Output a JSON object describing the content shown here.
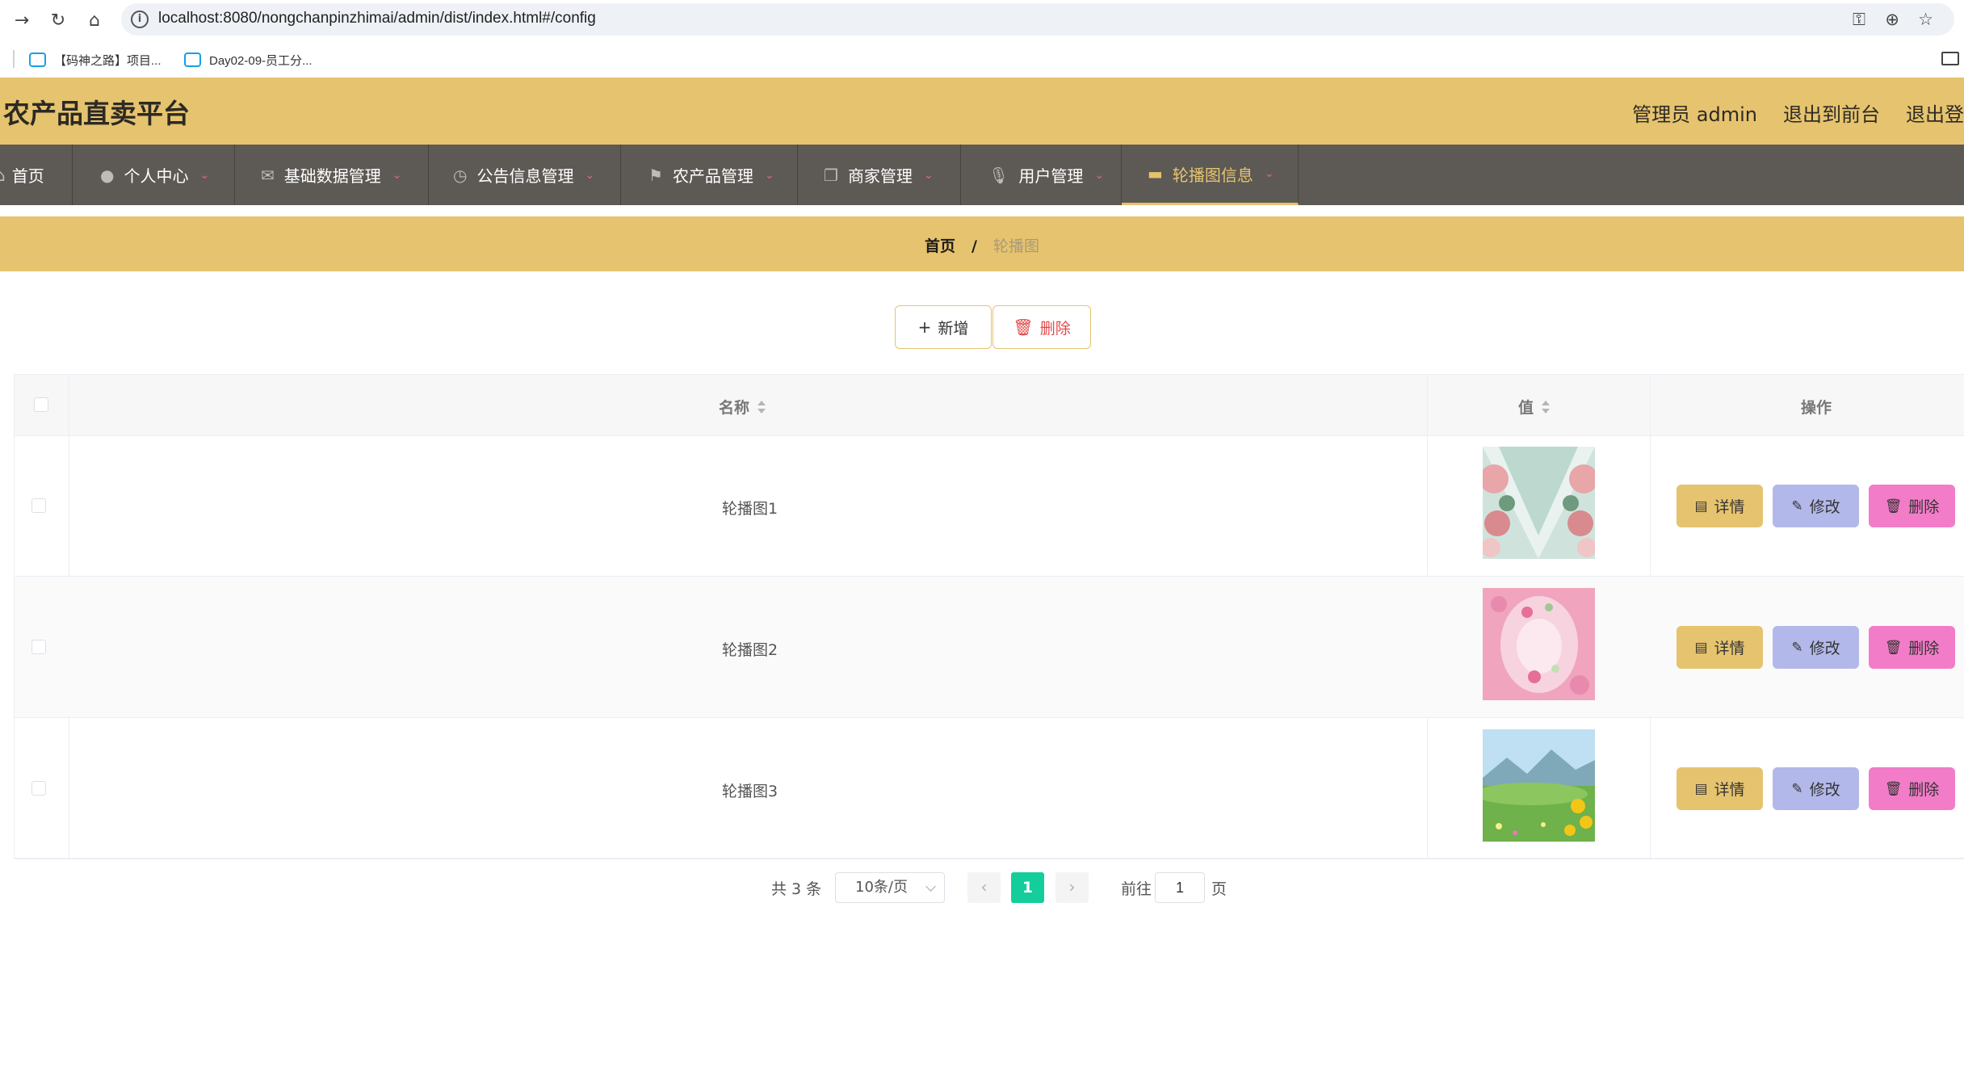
{
  "browser": {
    "url": "localhost:8080/nongchanpinzhimai/admin/dist/index.html#/config",
    "bookmarks": [
      "【码神之路】项目...",
      "Day02-09-员工分..."
    ]
  },
  "header": {
    "title": "农产品直卖平台",
    "links": [
      "管理员 admin",
      "退出到前台",
      "退出登"
    ]
  },
  "nav": {
    "items": [
      {
        "label": "首页",
        "icon": "home-icon"
      },
      {
        "label": "个人中心",
        "icon": "user-icon"
      },
      {
        "label": "基础数据管理",
        "icon": "mail-icon"
      },
      {
        "label": "公告信息管理",
        "icon": "clock-icon"
      },
      {
        "label": "农产品管理",
        "icon": "flag-icon"
      },
      {
        "label": "商家管理",
        "icon": "copy-icon"
      },
      {
        "label": "用户管理",
        "icon": "microphone-icon"
      },
      {
        "label": "轮播图信息",
        "icon": "printer-icon"
      }
    ],
    "active_index": 7,
    "active_color": "#e6c36e"
  },
  "breadcrumb": {
    "home": "首页",
    "separator": "/",
    "current": "轮播图"
  },
  "actions": {
    "add_label": "新增",
    "delete_label": "删除"
  },
  "table": {
    "columns": [
      "名称",
      "值",
      "操作"
    ],
    "rows": [
      {
        "name": "轮播图1",
        "image": "floral-mirror-image"
      },
      {
        "name": "轮播图2",
        "image": "pink-blossom-image"
      },
      {
        "name": "轮播图3",
        "image": "meadow-sunflower-image"
      }
    ],
    "row_actions": {
      "detail": "详情",
      "edit": "修改",
      "delete": "删除"
    }
  },
  "pagination": {
    "total": "共 3 条",
    "page_size": "10条/页",
    "current_page": "1",
    "goto_label": "前往",
    "goto_value": "1",
    "page_suffix": "页"
  },
  "colors": {
    "theme": "#e6c36e",
    "nav_bg": "#5d5a55",
    "detail_btn": "#e6c36e",
    "edit_btn": "#b3b8ea",
    "delete_btn": "#f27cc8",
    "page_active": "#13ce9b"
  }
}
